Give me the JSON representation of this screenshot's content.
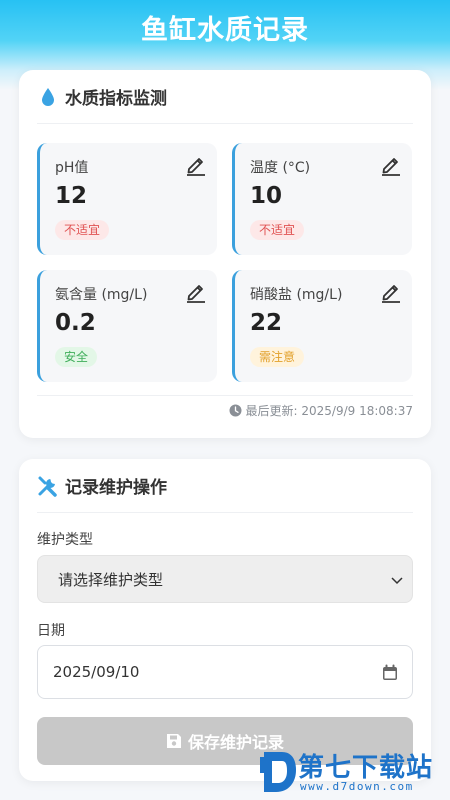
{
  "app": {
    "title": "鱼缸水质记录"
  },
  "quality": {
    "title": "水质指标监测",
    "metrics": [
      {
        "label": "pH值",
        "value": "12",
        "status": "不适宜"
      },
      {
        "label": "温度 (°C)",
        "value": "10",
        "status": "不适宜"
      },
      {
        "label": "氨含量 (mg/L)",
        "value": "0.2",
        "status": "安全"
      },
      {
        "label": "硝酸盐 (mg/L)",
        "value": "22",
        "status": "需注意"
      }
    ],
    "updated": "最后更新: 2025/9/9 18:08:37"
  },
  "maintenance": {
    "title": "记录维护操作",
    "type_label": "维护类型",
    "type_value": "请选择维护类型",
    "date_label": "日期",
    "date_value": "2025/09/10",
    "save_label": "保存维护记录"
  },
  "watermark": {
    "name": "第七下载站",
    "url": "www.d7down.com"
  },
  "colors": {
    "header": "#27c1f3",
    "accent": "#3ba0dd",
    "bad": "#e05252",
    "ok": "#3fae5a",
    "warn": "#e2a02a",
    "button_disabled": "#c8c8c8"
  },
  "icons": {
    "quality_head": "water-drop-icon",
    "maintenance_head": "tools-icon",
    "edit": "pencil-icon",
    "updated": "clock-icon",
    "select": "chevron-down-icon",
    "date": "calendar-icon",
    "save": "floppy-disk-icon"
  }
}
